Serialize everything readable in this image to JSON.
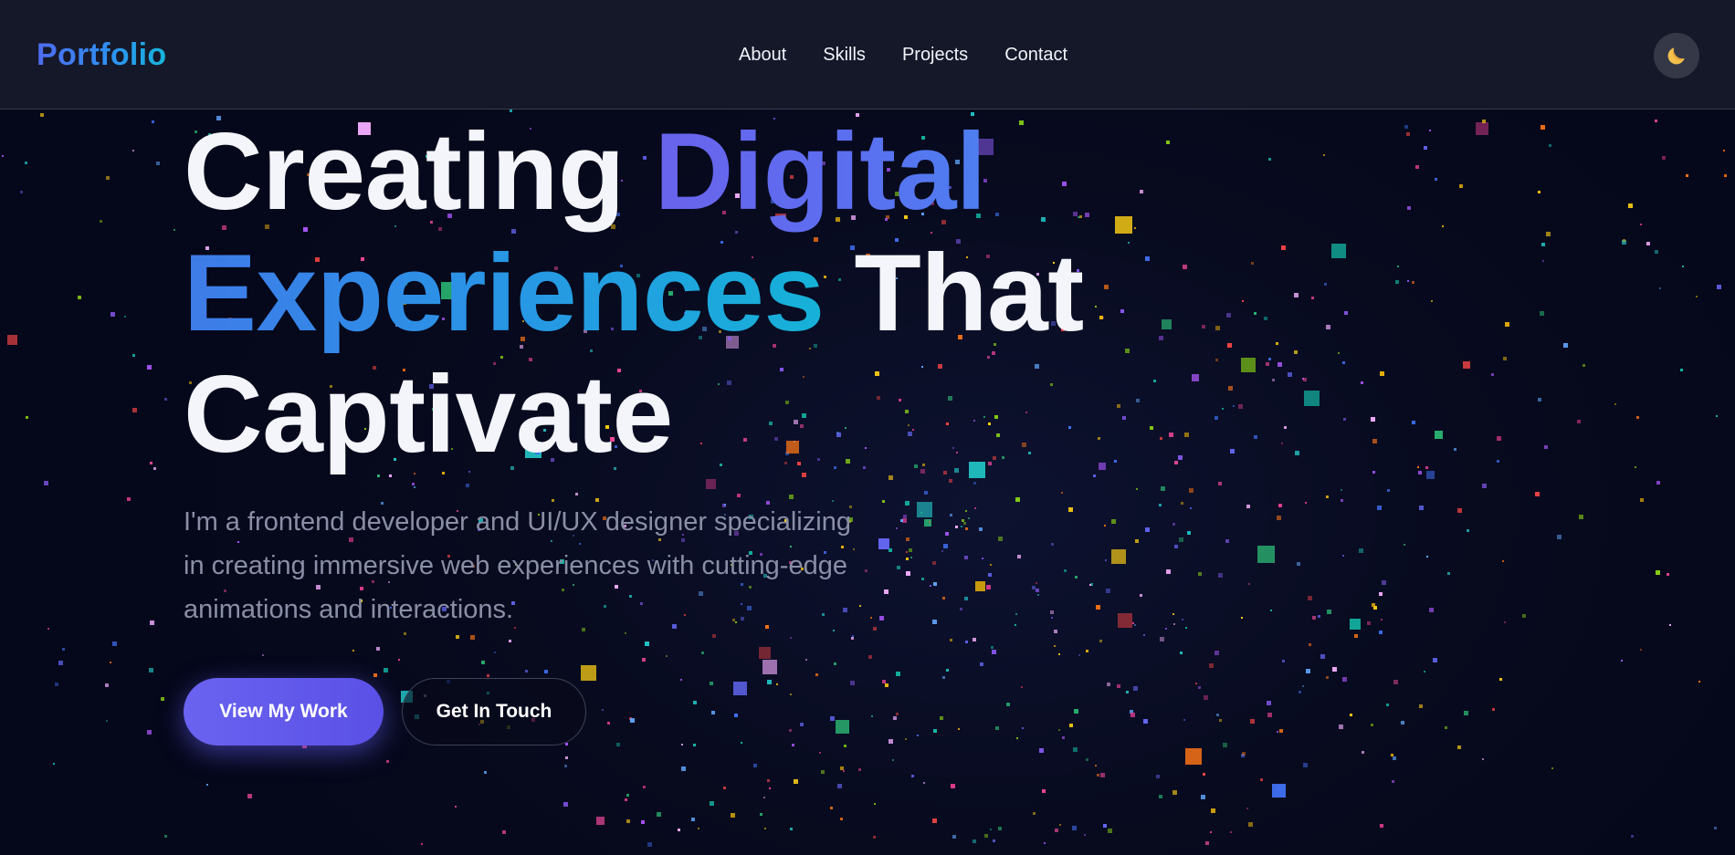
{
  "nav": {
    "logo": "Portfolio",
    "links": [
      "About",
      "Skills",
      "Projects",
      "Contact"
    ],
    "theme_toggle_icon": "moon-icon"
  },
  "hero": {
    "title_parts": [
      "Creating",
      "Digital",
      "Experiences",
      "That",
      "Captivate"
    ],
    "description": "I'm a frontend developer and UI/UX designer specializing in creating immersive web experiences with cutting-edge animations and interactions.",
    "primary_button": "View My Work",
    "secondary_button": "Get In Touch"
  },
  "colors": {
    "background": "#070a1c",
    "navbar": "#171a2a",
    "accent_purple": "#6a63ec",
    "accent_blue": "#2f8ff0",
    "accent_cyan": "#16b2d8",
    "text_primary": "#f4f5fa",
    "text_muted": "#8a8fa6"
  },
  "background_effect": "colored-square-particle-field"
}
